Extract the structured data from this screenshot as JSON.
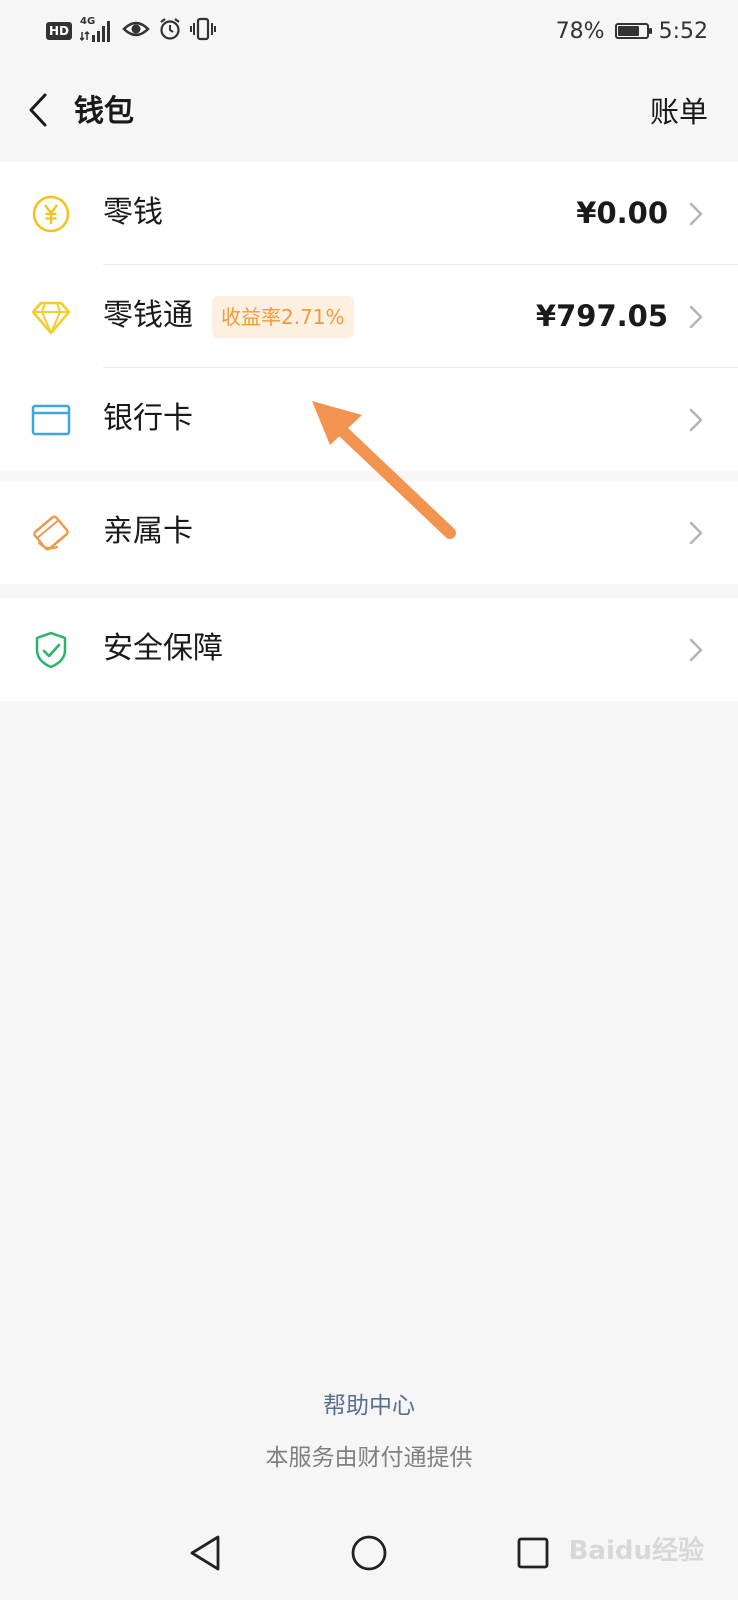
{
  "status_bar": {
    "network_badge": "HD",
    "network_type": "4G",
    "battery": "78%",
    "battery_level": 0.78,
    "time": "5:52"
  },
  "header": {
    "title": "钱包",
    "bill_label": "账单",
    "back_icon": "chevron-left-icon"
  },
  "wallet_group": [
    {
      "label": "零钱",
      "amount": "¥0.00",
      "icon": "yuan-coin-icon",
      "icon_color": "#f2c31c"
    },
    {
      "label": "零钱通",
      "badge": "收益率2.71%",
      "amount": "¥797.05",
      "icon": "diamond-icon",
      "icon_color": "#f5cd2a"
    },
    {
      "label": "银行卡",
      "icon": "bank-card-icon",
      "icon_color": "#3da8df"
    }
  ],
  "family_group": {
    "label": "亲属卡",
    "icon": "family-card-icon",
    "icon_color": "#eb9a4e"
  },
  "security_group": {
    "label": "安全保障",
    "icon": "shield-check-icon",
    "icon_color": "#2bb36a"
  },
  "footer": {
    "help_label": "帮助中心",
    "provider_note": "本服务由财付通提供"
  },
  "annotation": {
    "arrow_color": "#f29450"
  },
  "nav_bar": {
    "back_icon": "triangle-back-icon",
    "home_icon": "circle-home-icon",
    "recents_icon": "square-recents-icon"
  },
  "watermark": "Baidu经验",
  "colors": {
    "accent_badge_bg": "#fdf0e1",
    "accent_badge_text": "#ee9b3a",
    "link": "#586e92"
  }
}
